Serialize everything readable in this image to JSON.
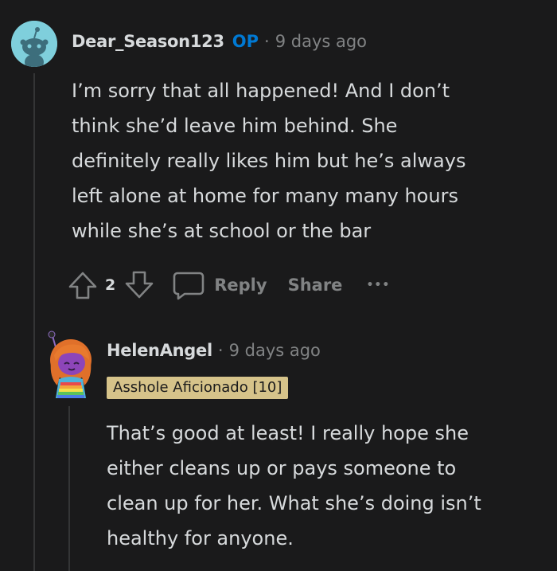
{
  "comments": [
    {
      "username": "Dear_Season123",
      "op_label": "OP",
      "separator": "·",
      "timestamp": "9 days ago",
      "avatar_icon": "reddit-snoo-avatar",
      "body": [
        "I’m sorry that all happened! And I don’t",
        "think she’d leave him behind. She",
        "definitely really likes him but he’s always",
        "left alone at home for many many hours",
        "while she’s at school or the bar"
      ],
      "vote_count": "2",
      "reply_label": "Reply",
      "share_label": "Share",
      "more_label": "•••"
    },
    {
      "username": "HelenAngel",
      "separator": "·",
      "timestamp": "9 days ago",
      "avatar_icon": "custom-orange-hair-avatar",
      "flair": "Asshole Aficionado [10]",
      "body": [
        "That’s good at least! I really hope she",
        "either cleans up or pays someone to",
        "clean up for her. What she’s doing isn’t",
        "healthy for anyone."
      ]
    }
  ],
  "colors": {
    "background": "#1a1a1b",
    "text": "#d7dadc",
    "muted": "#818384",
    "op_blue": "#0079d3",
    "flair_bg": "#d6c38a",
    "thread_line": "#343536"
  }
}
